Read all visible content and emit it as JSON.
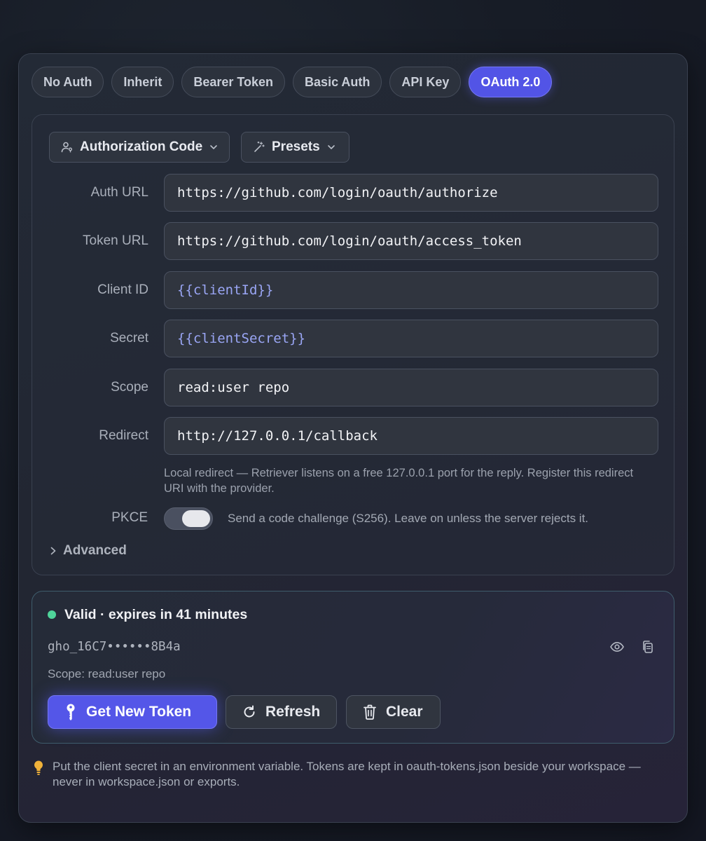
{
  "tabs": [
    {
      "label": "No Auth",
      "active": false
    },
    {
      "label": "Inherit",
      "active": false
    },
    {
      "label": "Bearer Token",
      "active": false
    },
    {
      "label": "Basic Auth",
      "active": false
    },
    {
      "label": "API Key",
      "active": false
    },
    {
      "label": "OAuth 2.0",
      "active": true
    }
  ],
  "grant_type": {
    "label": "Authorization Code",
    "icon": "user-key-icon"
  },
  "presets": {
    "label": "Presets",
    "icon": "magic-wand-icon"
  },
  "fields": {
    "auth_url": {
      "label": "Auth URL",
      "value": "https://github.com/login/oauth/authorize"
    },
    "token_url": {
      "label": "Token URL",
      "value": "https://github.com/login/oauth/access_token"
    },
    "client_id": {
      "label": "Client ID",
      "value": "{{clientId}}"
    },
    "secret": {
      "label": "Secret",
      "value": "{{clientSecret}}"
    },
    "scope": {
      "label": "Scope",
      "value": "read:user repo"
    },
    "redirect": {
      "label": "Redirect",
      "value": "http://127.0.0.1/callback"
    }
  },
  "redirect_hint": "Local redirect — Retriever listens on a free 127.0.0.1 port for the reply. Register this redirect URI with the provider.",
  "pkce": {
    "label": "PKCE",
    "enabled": true,
    "description": "Send a code challenge (S256). Leave on unless the server rejects it."
  },
  "advanced": {
    "label": "Advanced"
  },
  "token": {
    "status": "Valid · expires in 41 minutes",
    "status_color": "#4fd49a",
    "value": "gho_16C7••••••8B4a",
    "scope_line": "Scope: read:user repo"
  },
  "actions": {
    "get_new_token": "Get New Token",
    "refresh": "Refresh",
    "clear": "Clear"
  },
  "footnote": "Put the client secret in an environment variable. Tokens are kept in oauth-tokens.json beside your workspace — never in workspace.json or exports.",
  "colors": {
    "accent": "#5456e8",
    "variable": "#9aa6f5",
    "valid": "#4fd49a",
    "hint_bulb": "#f0b23a"
  }
}
